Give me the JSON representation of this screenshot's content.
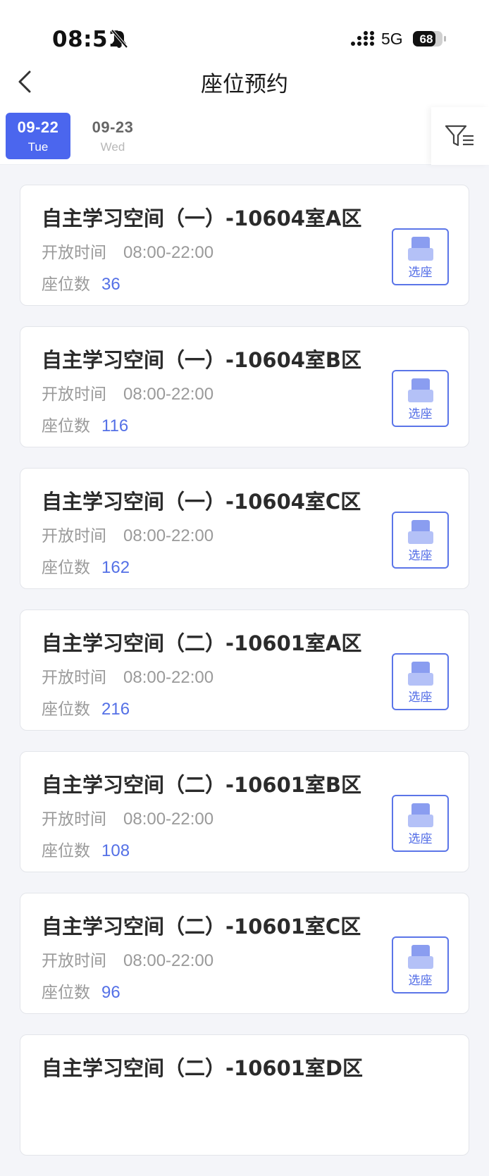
{
  "status_bar": {
    "time": "08:51",
    "network": "5G",
    "battery": "68"
  },
  "nav": {
    "title": "座位预约"
  },
  "dates": [
    {
      "date": "09-22",
      "weekday": "Tue"
    },
    {
      "date": "09-23",
      "weekday": "Wed"
    }
  ],
  "colors": {
    "accent": "#4b66ee",
    "seat_count": "#5470e6"
  },
  "labels": {
    "open_time": "开放时间",
    "seat_count": "座位数",
    "select_seat": "选座"
  },
  "rooms": [
    {
      "name": "自主学习空间（一）-10604室A区",
      "hours": "08:00-22:00",
      "seats": "36"
    },
    {
      "name": "自主学习空间（一）-10604室B区",
      "hours": "08:00-22:00",
      "seats": "116"
    },
    {
      "name": "自主学习空间（一）-10604室C区",
      "hours": "08:00-22:00",
      "seats": "162"
    },
    {
      "name": "自主学习空间（二）-10601室A区",
      "hours": "08:00-22:00",
      "seats": "216"
    },
    {
      "name": "自主学习空间（二）-10601室B区",
      "hours": "08:00-22:00",
      "seats": "108"
    },
    {
      "name": "自主学习空间（二）-10601室C区",
      "hours": "08:00-22:00",
      "seats": "96"
    },
    {
      "name": "自主学习空间（二）-10601室D区",
      "hours": "",
      "seats": ""
    }
  ]
}
